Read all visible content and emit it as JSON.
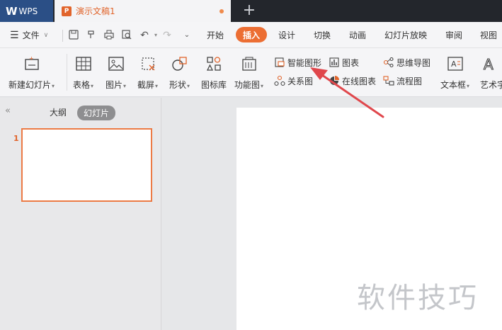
{
  "tabbar": {
    "app_label": "WPS",
    "document_tab": "演示文稿1",
    "new_tab": "+"
  },
  "menubar": {
    "file_label": "文件",
    "tabs": [
      "开始",
      "插入",
      "设计",
      "切换",
      "动画",
      "幻灯片放映",
      "审阅",
      "视图"
    ],
    "active_tab": "插入"
  },
  "ribbon": {
    "new_slide": "新建幻灯片",
    "table": "表格",
    "picture": "图片",
    "screenshot": "截屏",
    "shape": "形状",
    "icon_library": "图标库",
    "function_chart": "功能图",
    "smart_graphic": "智能图形",
    "chart": "图表",
    "mind_map": "思维导图",
    "relation_chart": "关系图",
    "online_chart": "在线图表",
    "flowchart": "流程图",
    "text_box": "文本框",
    "art_text": "艺术字"
  },
  "left_panel": {
    "outline_tab": "大纲",
    "slides_tab": "幻灯片",
    "slide_number": "1"
  },
  "watermark": "软件技巧",
  "colors": {
    "accent": "#ec6e33",
    "tabbar_bg": "#23262c",
    "wps_tab_bg": "#2b4f86",
    "annotation_arrow": "#e0474c"
  }
}
